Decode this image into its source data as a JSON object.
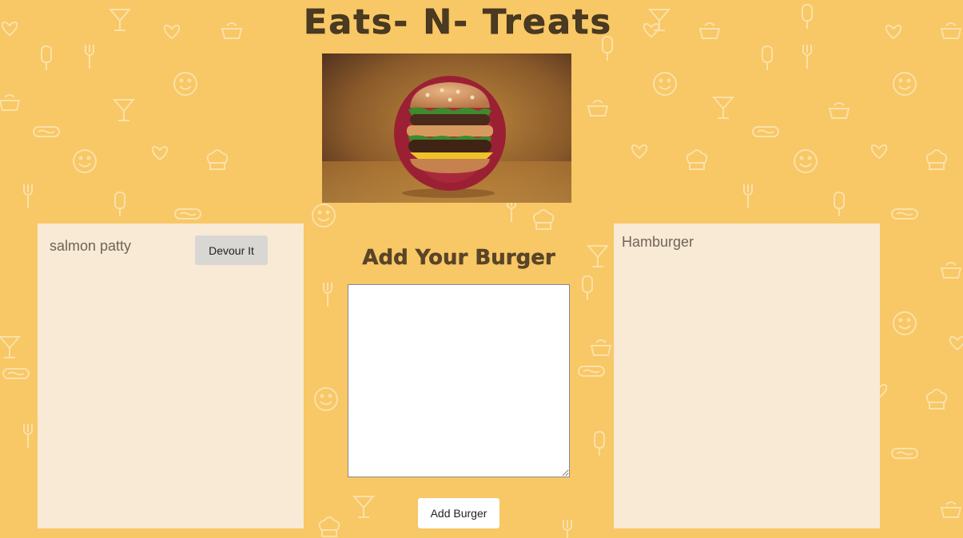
{
  "app": {
    "title": "Eats- N- Treats"
  },
  "hero_image": {
    "icon": "burger-photo"
  },
  "uneaten": {
    "items": [
      {
        "name": "salmon patty",
        "button_label": "Devour It"
      }
    ]
  },
  "form": {
    "heading": "Add Your Burger",
    "input_value": "",
    "submit_label": "Add Burger"
  },
  "devoured": {
    "items": [
      {
        "name": "Hamburger"
      }
    ]
  },
  "colors": {
    "background": "#f8c766",
    "panel": "#f9ead5"
  }
}
